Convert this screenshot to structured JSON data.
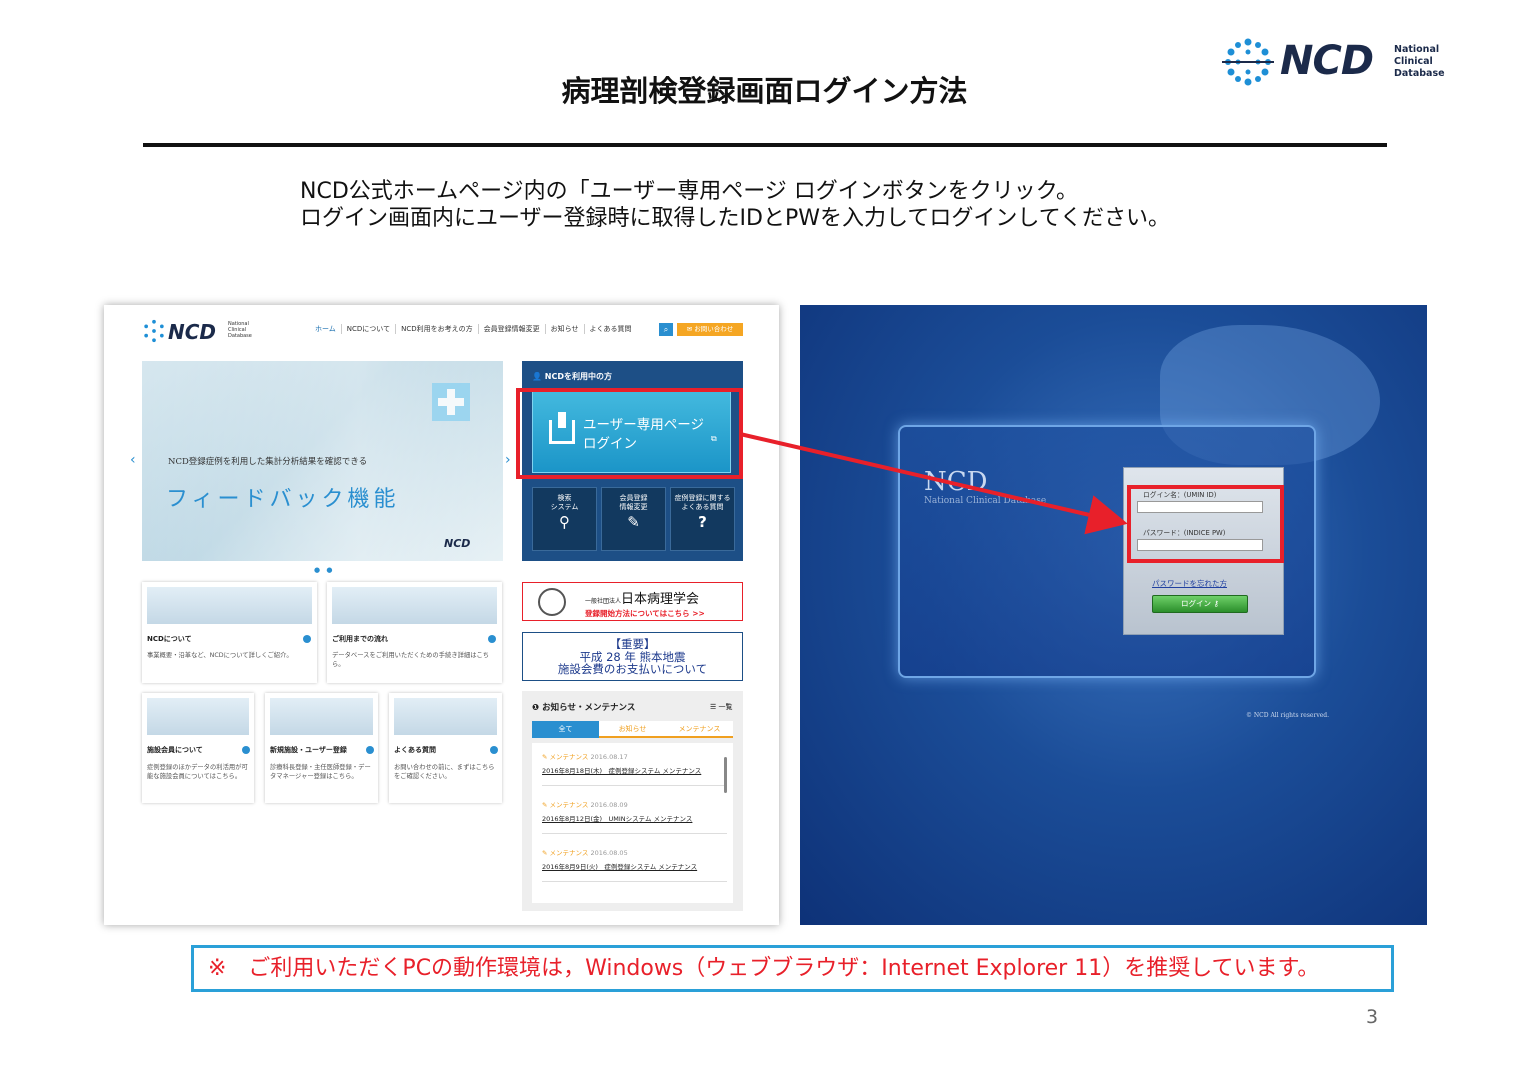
{
  "slide": {
    "title": "病理剖検登録画面ログイン方法",
    "logo": {
      "word": "NCD",
      "sub": [
        "National",
        "Clinical",
        "Database"
      ]
    },
    "instructions": [
      "NCD公式ホームページ内の「ユーザー専用ページ ログインボタンをクリック。",
      "ログイン画面内にユーザー登録時に取得したIDとPWを入力してログインしてください。"
    ],
    "note": "※　ご利用いただくPCの動作環境は，Windows（ウェブブラウザ：Internet Explorer 11）を推奨しています。",
    "page_number": "3"
  },
  "homepage": {
    "logo": {
      "word": "NCD",
      "sub": [
        "National",
        "Clinical",
        "Database"
      ]
    },
    "nav": [
      "ホーム",
      "NCDについて",
      "NCD利用をお考えの方",
      "会員登録情報変更",
      "お知らせ",
      "よくある質問"
    ],
    "search_icon": "search-icon",
    "contact_label": "✉ お問い合わせ",
    "hero": {
      "sub": "NCD登録症例を利用した集計分析結果を確認できる",
      "main": "フィードバック機能",
      "mini_logo": "NCD"
    },
    "user_panel": {
      "caption": "NCDを利用中の方",
      "login_line1": "ユーザー専用ページ",
      "login_line2": "ログイン",
      "tiles": [
        {
          "line1": "検索",
          "line2": "システム",
          "icon": "search-icon",
          "glyph": "Q"
        },
        {
          "line1": "会員登録",
          "line2": "情報変更",
          "icon": "edit-icon",
          "glyph": "✎"
        },
        {
          "line1": "症例登録に関する",
          "line2": "よくある質問",
          "icon": "question-icon",
          "glyph": "?"
        }
      ]
    },
    "cards": [
      {
        "title": "NCDについて",
        "desc": "事業概要・沿革など、NCDについて詳しくご紹介。"
      },
      {
        "title": "ご利用までの流れ",
        "desc": "データベースをご利用いただくための手続き詳細はこちら。"
      },
      {
        "title": "施設会員について",
        "desc": "症例登録のほかデータの利活用が可能な施設会員についてはこちら。"
      },
      {
        "title": "新規施設・ユーザー登録",
        "desc": "診療科長登録・主任医師登録・データマネージャー登録はこちら。"
      },
      {
        "title": "よくある質問",
        "desc": "お問い合わせの前に、まずはこちらをご確認ください。"
      }
    ],
    "banner_society": {
      "prefix": "一般社団法人",
      "name": "日本病理学会",
      "link": "登録開始方法についてはこちら >>"
    },
    "banner_notice": [
      "【重要】",
      "平成 28 年 熊本地震",
      "施設会費のお支払いについて"
    ],
    "news": {
      "heading": "お知らせ・メンテナンス",
      "all": "一覧",
      "tabs": [
        "全て",
        "お知らせ",
        "メンテナンス"
      ],
      "items": [
        {
          "kind": "メンテナンス",
          "date": "2016.08.17",
          "title": "2016年8月18日(木)　症例登録システム メンテナンス"
        },
        {
          "kind": "メンテナンス",
          "date": "2016.08.09",
          "title": "2016年8月12日(金)　UMINシステム メンテナンス"
        },
        {
          "kind": "メンテナンス",
          "date": "2016.08.05",
          "title": "2016年8月9日(火)　症例登録システム メンテナンス"
        }
      ]
    }
  },
  "login_page": {
    "brand": "NCD",
    "brand_sub": "National Clinical Database",
    "login_name_label": "ログイン名：(UMIN ID)",
    "login_name_value": "",
    "password_label": "パスワード：(INDICE PW)",
    "password_value": "",
    "forgot_link": "パスワードを忘れた方",
    "login_button": "ログイン",
    "copyright": "© NCD All rights reserved."
  },
  "colors": {
    "highlight_red": "#e8202a",
    "note_border": "#2aa0d8",
    "panel_blue": "#1d4f86"
  }
}
